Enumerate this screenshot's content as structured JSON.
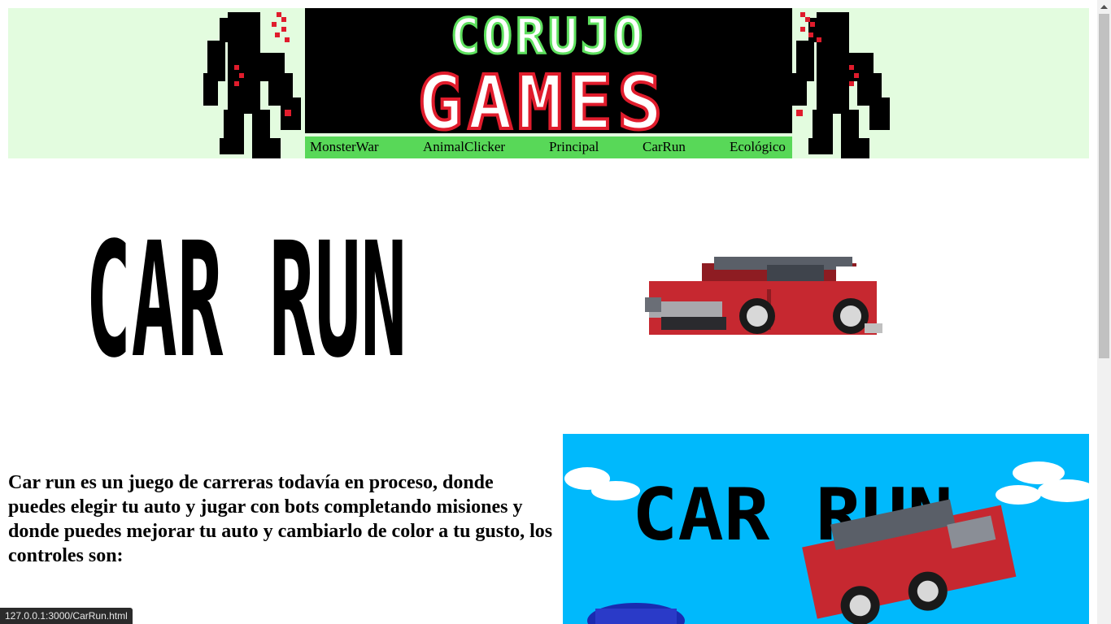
{
  "header": {
    "logo_line1": "CORUJO",
    "logo_line2": "GAMES",
    "nav": [
      {
        "label": "MonsterWar"
      },
      {
        "label": "AnimalClicker"
      },
      {
        "label": "Principal"
      },
      {
        "label": "CarRun"
      },
      {
        "label": "Ecológico"
      }
    ]
  },
  "main": {
    "title_image_text": "CAR RUN",
    "description": "Car run es un juego de carreras todavía en proceso, donde puedes elegir tu auto y jugar con bots completando misiones y donde puedes mejorar tu auto y cambiarlo de color a tu gusto, los controles son:",
    "screenshot_title_text": "CAR RUN"
  },
  "status_bar": {
    "url": "127.0.0.1:3000/CarRun.html"
  },
  "colors": {
    "banner_bg": "#e3fcdf",
    "nav_bg": "#58d858",
    "logo_green": "#5ee05e",
    "logo_red": "#e01c2c",
    "sky": "#00b9fc",
    "car_red": "#c62830"
  }
}
